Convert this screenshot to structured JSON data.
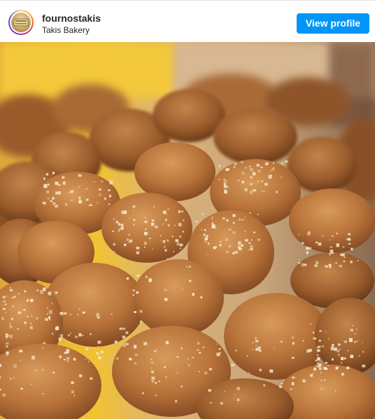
{
  "post": {
    "username": "fournostakis",
    "subtitle": "Takis Bakery",
    "view_profile_label": "View profile",
    "accent_color": "#0095f6"
  },
  "media": {
    "subject": "pile of honey cookies topped with crushed walnuts",
    "icon": "photo"
  }
}
